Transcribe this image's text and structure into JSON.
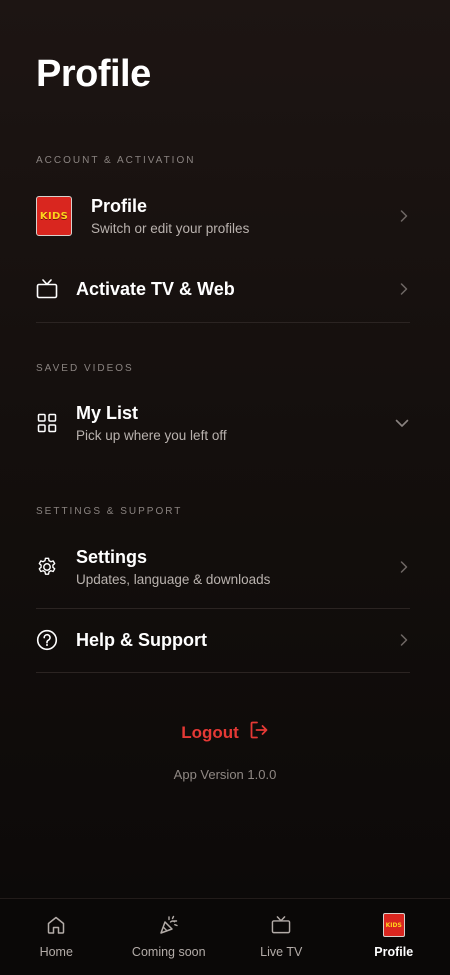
{
  "header": {
    "title": "Profile"
  },
  "sections": {
    "account": {
      "label": "ACCOUNT & ACTIVATION",
      "profile": {
        "avatar_text": "KIDS",
        "title": "Profile",
        "subtitle": "Switch or edit your profiles"
      },
      "activate": {
        "title": "Activate TV & Web"
      }
    },
    "saved": {
      "label": "SAVED VIDEOS",
      "my_list": {
        "title": "My List",
        "subtitle": "Pick up where you left off"
      }
    },
    "settings": {
      "label": "SETTINGS & SUPPORT",
      "settings": {
        "title": "Settings",
        "subtitle": "Updates, language & downloads"
      },
      "help": {
        "title": "Help & Support"
      }
    }
  },
  "logout": {
    "label": "Logout",
    "icon": "logout-icon"
  },
  "app_version": "App Version 1.0.0",
  "tabbar": {
    "tabs": [
      {
        "label": "Home",
        "icon": "home-icon",
        "active": false
      },
      {
        "label": "Coming soon",
        "icon": "party-popper-icon",
        "active": false
      },
      {
        "label": "Live TV",
        "icon": "tv-icon",
        "active": false
      },
      {
        "label": "Profile",
        "icon": "kids-avatar-icon",
        "avatar_text": "KIDS",
        "active": true
      }
    ]
  },
  "colors": {
    "accent": "#e53935",
    "background": "#140f0d",
    "text_secondary": "#b9b2ae",
    "section_label": "#8a8380",
    "kids_red": "#d9261f",
    "kids_yellow": "#ffd21c"
  }
}
